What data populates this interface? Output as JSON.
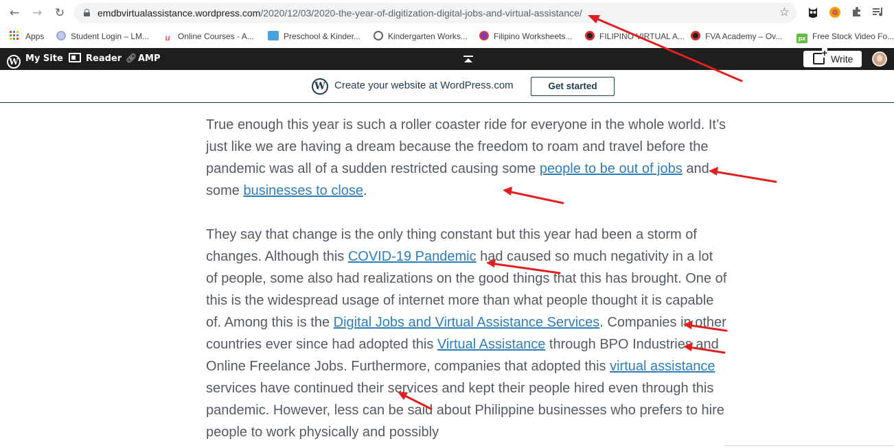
{
  "browser": {
    "url_domain": "emdbvirtualassistance.wordpress.com",
    "url_path": "/2020/12/03/2020-the-year-of-digitization-digital-jobs-and-virtual-assistance/"
  },
  "bookmarks": [
    {
      "label": "Apps",
      "icon": "apps-grid-icon",
      "color": "#e8453c"
    },
    {
      "label": "Student Login – LM...",
      "icon": "globe-icon",
      "color": "#9aa6e0"
    },
    {
      "label": "Online Courses - A...",
      "icon": "udemy-icon",
      "color": "#ec5252"
    },
    {
      "label": "Preschool & Kinder...",
      "icon": "preschool-icon",
      "color": "#4aa3d8"
    },
    {
      "label": "Kindergarten Works...",
      "icon": "globe-icon",
      "color": "#5f6368"
    },
    {
      "label": "Filipino Worksheets...",
      "icon": "heart-icon",
      "color": "#7b3fb5"
    },
    {
      "label": "FILIPINO VIRTUAL A...",
      "icon": "fva-icon",
      "color": "#222222"
    },
    {
      "label": "FVA Academy – Ov...",
      "icon": "fva-icon",
      "color": "#222222"
    },
    {
      "label": "Free Stock Video Fo...",
      "icon": "pexels-icon",
      "color": "#66bb44"
    }
  ],
  "adminbar": {
    "my_site": "My Site",
    "reader": "Reader",
    "amp": "AMP",
    "write": "Write"
  },
  "banner": {
    "text": "Create your website at WordPress.com",
    "button": "Get started"
  },
  "article": {
    "p1": {
      "t1": "True enough this year is such a roller coaster ride for everyone in the whole world. It’s just like we are having a dream because the freedom to roam and travel before the pandemic was all of a sudden restricted causing some ",
      "link1": "people to be out of jobs",
      "t2": " and some ",
      "link2": "businesses to close",
      "t3": "."
    },
    "p2": {
      "t1": "They say that change is the only thing constant but this year had been a storm of changes. Although this ",
      "link1": "COVID-19 Pandemic",
      "t2": " had caused so much negativity in a lot of people, some also had realizations on the good things that this has brought. One of this is the widespread usage of internet more than what people thought it is capable of. Among this is the ",
      "link2": "Digital Jobs and Virtual Assistance Services",
      "t3": ". Companies in other countries ever since had adopted this ",
      "link3": "Virtual Assistance",
      "t4": " through BPO Industries and Online Freelance Jobs. Furthermore, companies that adopted this ",
      "link4": "virtual assistance",
      "t5": " services have continued their services and kept their people hired even through this pandemic. However, less can be said about Philippine businesses who prefers to hire people to work physically and possibly"
    }
  },
  "colors": {
    "adminbar": "#1e1e1e",
    "link": "#2f7db8",
    "annotation_arrow": "#e02020"
  }
}
